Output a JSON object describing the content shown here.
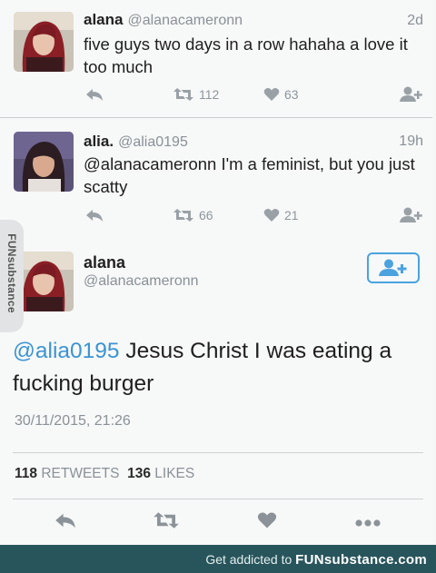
{
  "tweets": [
    {
      "name": "alana",
      "handle": "@alanacameronn",
      "time": "2d",
      "text": "five guys two days in a row hahaha a love it too much",
      "retweets": "112",
      "likes": "63"
    },
    {
      "name": "alia.",
      "handle": "@alia0195",
      "time": "19h",
      "text": "@alanacameronn I'm a feminist, but you just scatty",
      "retweets": "66",
      "likes": "21"
    }
  ],
  "main_tweet": {
    "name": "alana",
    "handle": "@alanacameronn",
    "mention": "@alia0195",
    "text": " Jesus Christ I was eating a fucking burger",
    "date": "30/11/2015, 21:26",
    "retweets_count": "118",
    "retweets_label": "RETWEETS",
    "likes_count": "136",
    "likes_label": "LIKES"
  },
  "watermark": {
    "side": "FUNsubstance",
    "footer_prefix": "Get addicted to ",
    "footer_brand": "FUNsubstance.com"
  },
  "colors": {
    "link": "#3a94d4",
    "icon": "#9aa1a6",
    "footer": "#28555b"
  },
  "icons": [
    "reply-icon",
    "retweet-icon",
    "heart-icon",
    "follow-icon",
    "more-icon"
  ]
}
